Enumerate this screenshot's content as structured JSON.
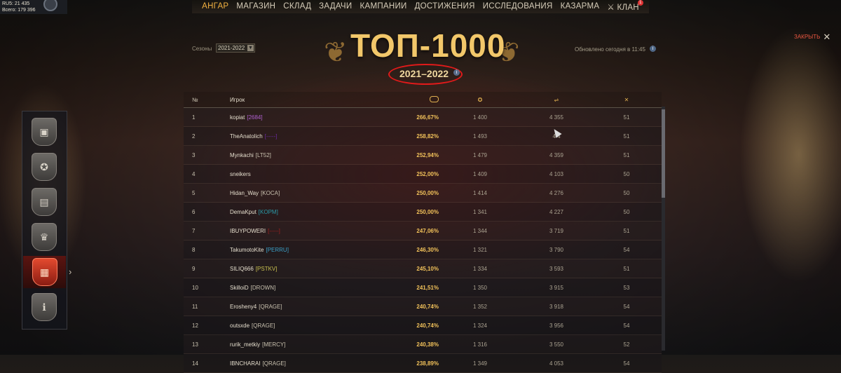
{
  "server": {
    "line1": "RU5: 21 435",
    "line2": "Всего: 179 396"
  },
  "nav": {
    "items": [
      "АНГАР",
      "МАГАЗИН",
      "СКЛАД",
      "ЗАДАЧИ",
      "КАМПАНИИ",
      "ДОСТИЖЕНИЯ",
      "ИССЛЕДОВАНИЯ",
      "КАЗАРМА"
    ],
    "clan": "КЛАН",
    "clan_badge": "1",
    "active_color": "#f0b040"
  },
  "header": {
    "seasons_label": "Сезоны",
    "season_selected": "2021-2022",
    "title": "ТОП-1000",
    "subtitle": "2021–2022",
    "updated": "Обновлено сегодня в 11:45",
    "close": "ЗАКРЫТЬ"
  },
  "table": {
    "headers": {
      "num": "№",
      "player": "Игрок"
    },
    "rows": [
      {
        "num": "1",
        "name": "kopiat",
        "clan": "[2684]",
        "clan_color": "#b060d0",
        "rate": "266,67%",
        "b": "1 400",
        "c": "4 355",
        "d": "51"
      },
      {
        "num": "2",
        "name": "TheAnatolich",
        "clan": "[-----]",
        "clan_color": "#6a2aa0",
        "rate": "258,82%",
        "b": "1 493",
        "c": "4 4",
        "d": "51"
      },
      {
        "num": "3",
        "name": "Mynkachi",
        "clan": "[LT52]",
        "clan_color": "#c8c0ae",
        "rate": "252,94%",
        "b": "1 479",
        "c": "4 359",
        "d": "51"
      },
      {
        "num": "4",
        "name": "sneikers",
        "clan": "",
        "clan_color": "#c8c0ae",
        "rate": "252,00%",
        "b": "1 409",
        "c": "4 103",
        "d": "50"
      },
      {
        "num": "5",
        "name": "Hidan_Way",
        "clan": "[KOCA]",
        "clan_color": "#c8c0ae",
        "rate": "250,00%",
        "b": "1 414",
        "c": "4 276",
        "d": "50"
      },
      {
        "num": "6",
        "name": "DemaKput",
        "clan": "[KOPM]",
        "clan_color": "#2a9aa8",
        "rate": "250,00%",
        "b": "1 341",
        "c": "4 227",
        "d": "50"
      },
      {
        "num": "7",
        "name": "IBUYPOWERI",
        "clan": "[-----]",
        "clan_color": "#a02020",
        "rate": "247,06%",
        "b": "1 344",
        "c": "3 719",
        "d": "51"
      },
      {
        "num": "8",
        "name": "TakumotoKite",
        "clan": "[PERRU]",
        "clan_color": "#3aa0c8",
        "rate": "246,30%",
        "b": "1 321",
        "c": "3 790",
        "d": "54"
      },
      {
        "num": "9",
        "name": "SILIQ666",
        "clan": "[PSTKV]",
        "clan_color": "#c8c050",
        "rate": "245,10%",
        "b": "1 334",
        "c": "3 593",
        "d": "51"
      },
      {
        "num": "10",
        "name": "SkilloiD",
        "clan": "[DROWN]",
        "clan_color": "#c8c0ae",
        "rate": "241,51%",
        "b": "1 350",
        "c": "3 915",
        "d": "53"
      },
      {
        "num": "11",
        "name": "Erosheny4",
        "clan": "[QRAGE]",
        "clan_color": "#c8c0ae",
        "rate": "240,74%",
        "b": "1 352",
        "c": "3 918",
        "d": "54"
      },
      {
        "num": "12",
        "name": "outsxde",
        "clan": "[QRAGE]",
        "clan_color": "#c8c0ae",
        "rate": "240,74%",
        "b": "1 324",
        "c": "3 956",
        "d": "54"
      },
      {
        "num": "13",
        "name": "rurik_metkiy",
        "clan": "[MERCY]",
        "clan_color": "#c8c0ae",
        "rate": "240,38%",
        "b": "1 316",
        "c": "3 550",
        "d": "52"
      },
      {
        "num": "14",
        "name": "IBNCHARAI",
        "clan": "[QRAGE]",
        "clan_color": "#c8c0ae",
        "rate": "238,89%",
        "b": "1 349",
        "c": "4 053",
        "d": "54"
      }
    ]
  },
  "sidebar": {
    "icons": [
      "tank-shield-icon",
      "medal-icon",
      "money-icon",
      "trophy-icon",
      "top-list-icon",
      "info-icon"
    ],
    "active_index": 4
  }
}
